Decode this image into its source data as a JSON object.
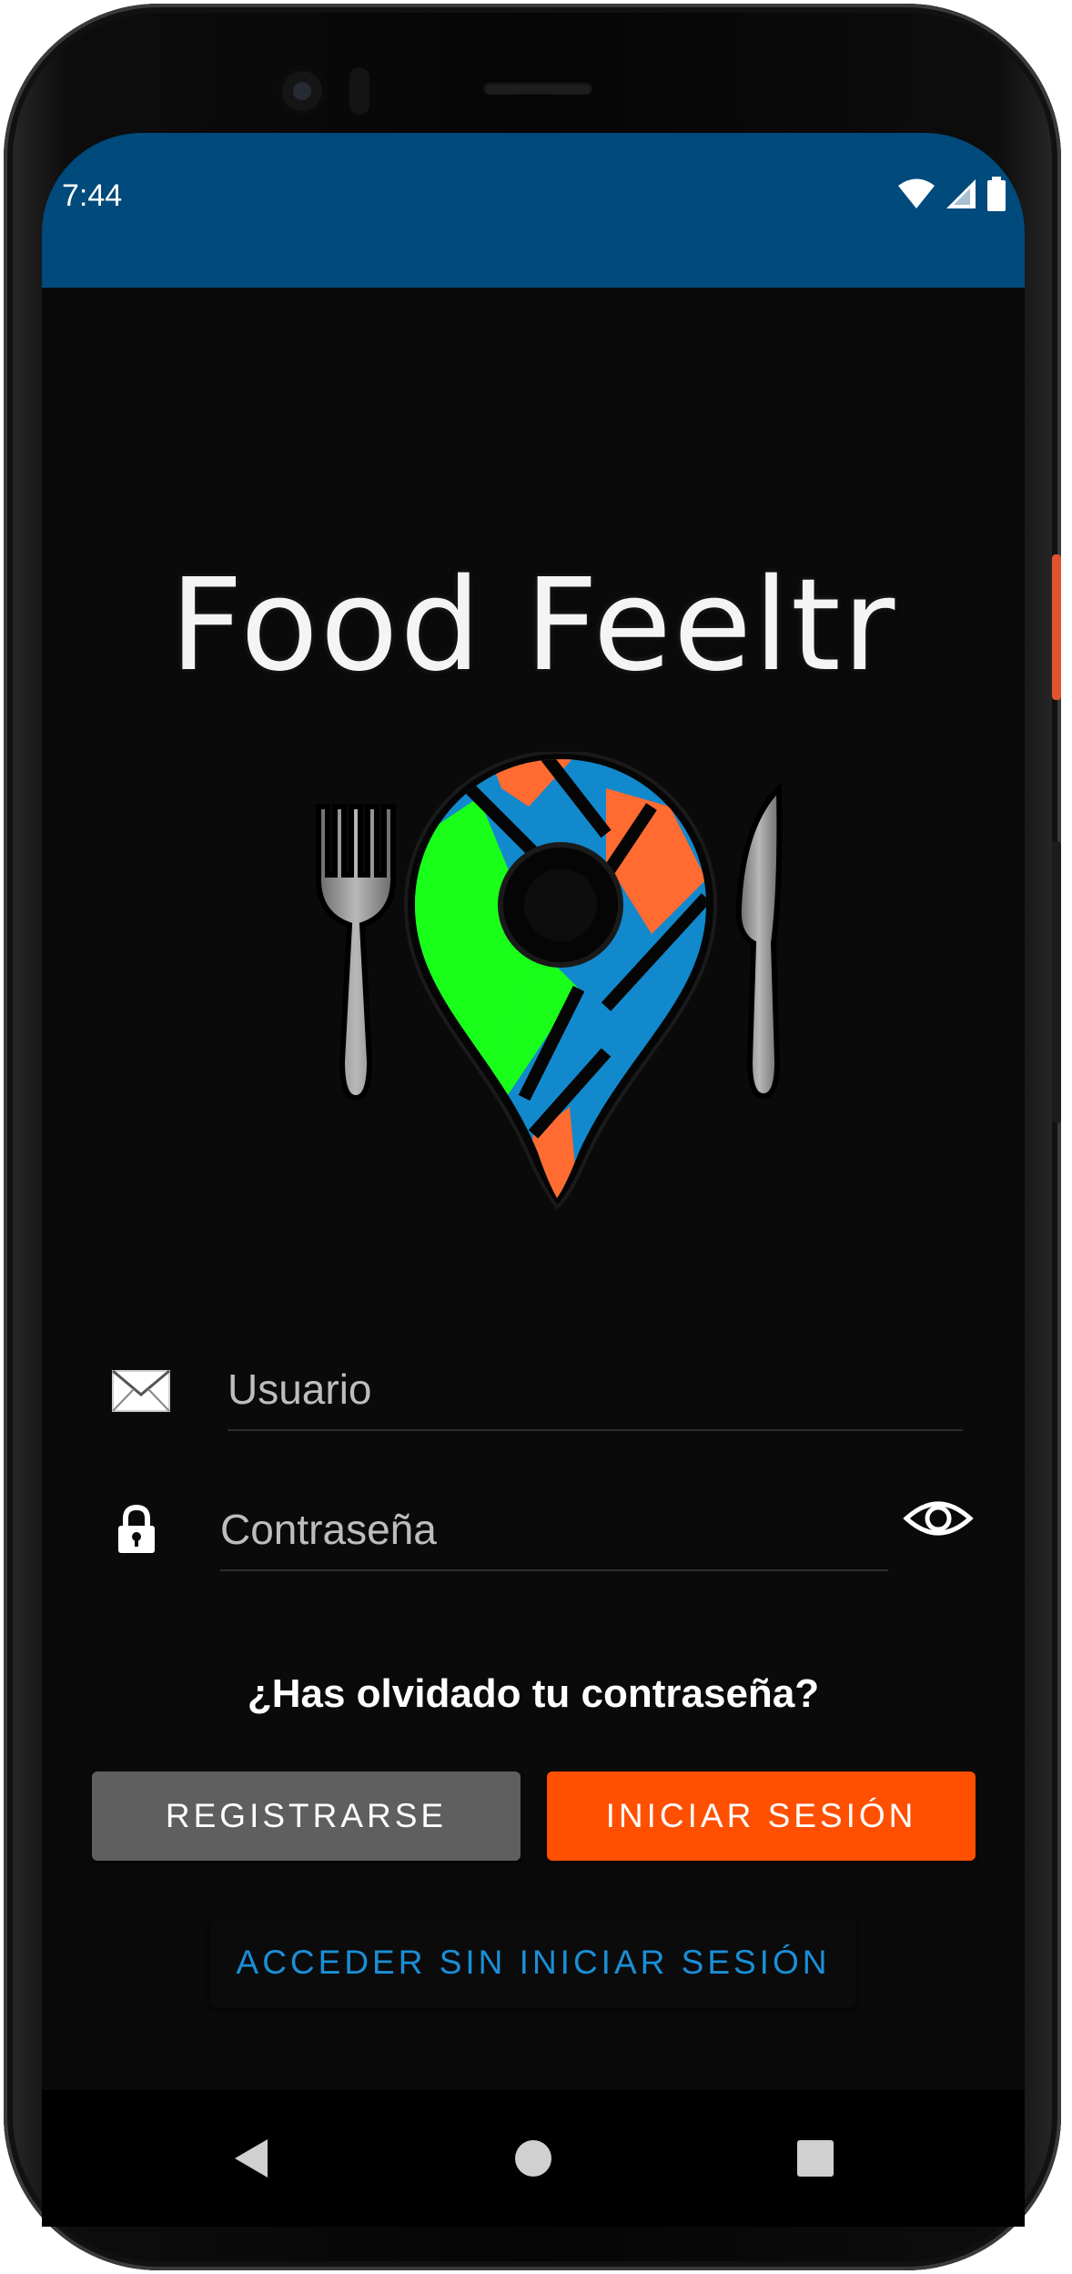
{
  "status_bar": {
    "time": "7:44",
    "color": "#004a7c",
    "icons": [
      "wifi-icon",
      "signal-icon",
      "battery-icon"
    ]
  },
  "app": {
    "title": "Food Feeltr",
    "logo_icon": "map-pin-with-fork-and-knife-icon"
  },
  "login_form": {
    "username_placeholder": "Usuario",
    "username_icon": "envelope-icon",
    "password_placeholder": "Contraseña",
    "password_icon": "lock-icon",
    "toggle_visibility_icon": "eye-icon",
    "forgot_password": "¿Has olvidado tu contraseña?"
  },
  "buttons": {
    "register_label": "REGISTRARSE",
    "register_color": "#5f5f5f",
    "login_label": "INICIAR SESIÓN",
    "login_color": "#ff4f00",
    "guest_label": "ACCEDER SIN INICIAR SESIÓN",
    "guest_color": "#1a8fd6"
  },
  "nav_bar": {
    "items": [
      "back-icon",
      "home-icon",
      "recents-icon"
    ]
  }
}
